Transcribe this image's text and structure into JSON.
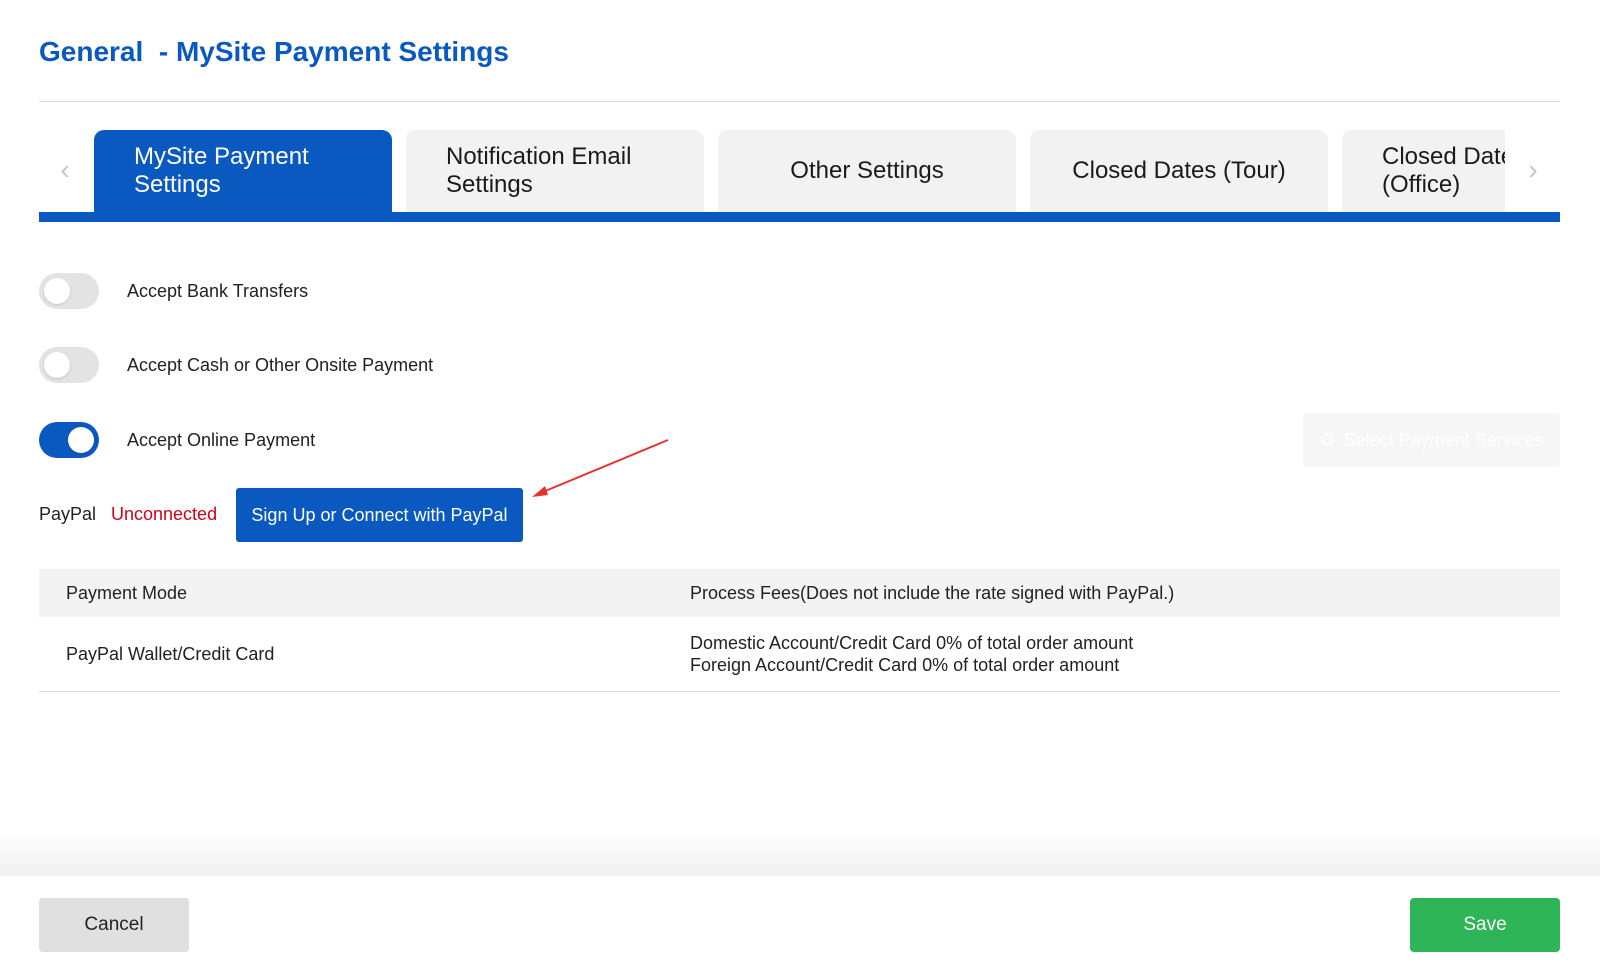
{
  "header": {
    "title": "General  - MySite Payment Settings"
  },
  "tabs": [
    {
      "line1": "MySite Payment",
      "line2": "Settings",
      "active": true
    },
    {
      "line1": "Notification Email",
      "line2": "Settings",
      "active": false
    },
    {
      "line1": "Other Settings",
      "line2": "",
      "active": false
    },
    {
      "line1": "Closed Dates (Tour)",
      "line2": "",
      "active": false
    },
    {
      "line1": "Closed Dates",
      "line2": "(Office)",
      "active": false
    }
  ],
  "tab_nav": {
    "prev_icon": "chevron-left-icon",
    "next_icon": "chevron-right-icon"
  },
  "payment_options": {
    "bank_transfers": {
      "label": "Accept Bank Transfers",
      "enabled": false
    },
    "cash_onsite": {
      "label": "Accept Cash or Other Onsite Payment",
      "enabled": false
    },
    "online_payment": {
      "label": "Accept Online Payment",
      "enabled": true
    }
  },
  "select_services": {
    "label": "Select Payment Services",
    "icon": "gear-icon"
  },
  "paypal": {
    "label": "PayPal",
    "status": "Unconnected",
    "button_label": "Sign Up or Connect with PayPal"
  },
  "fees_table": {
    "headers": [
      "Payment Mode",
      "Process Fees(Does not include the rate signed with PayPal.)"
    ],
    "rows": [
      {
        "mode": "PayPal Wallet/Credit Card",
        "fees": [
          "Domestic Account/Credit Card 0% of total order amount",
          "Foreign Account/Credit Card 0% of total order amount"
        ]
      }
    ]
  },
  "footer": {
    "cancel_label": "Cancel",
    "save_label": "Save"
  },
  "colors": {
    "primary": "#0a59c0",
    "save": "#2db558",
    "unconnected": "#d0021b",
    "annotation_arrow": "#e5322d"
  }
}
